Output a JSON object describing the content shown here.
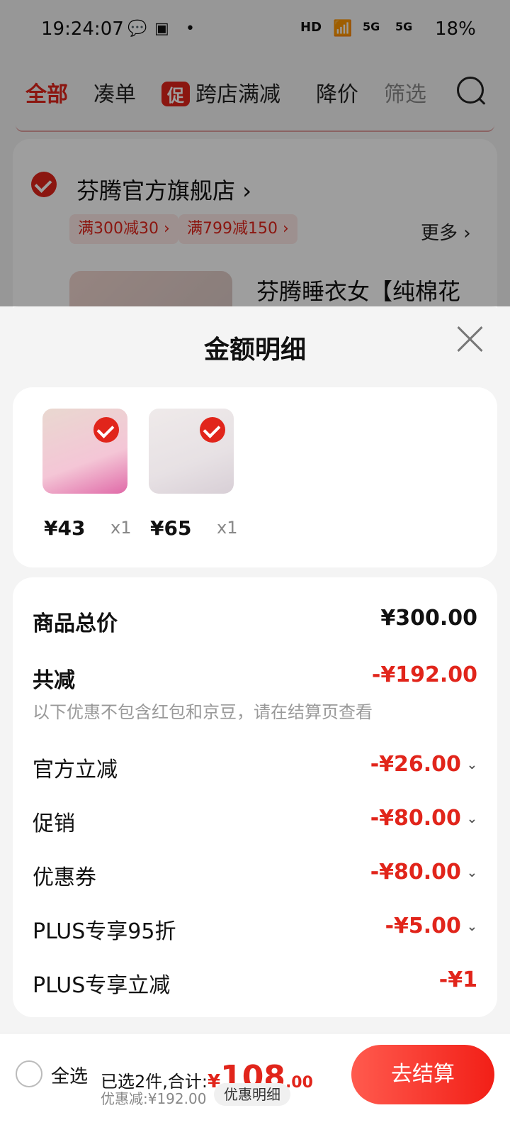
{
  "status_bar": {
    "time": "19:24:07",
    "battery": "18%",
    "net1": "HD",
    "net2": "5G",
    "net3": "5G"
  },
  "tabs": [
    {
      "label": "全部"
    },
    {
      "label": "凑单"
    },
    {
      "label": "跨店满减",
      "tag": "促"
    },
    {
      "label": "降价"
    },
    {
      "label": "筛选"
    }
  ],
  "store": {
    "name": "芬腾官方旗舰店",
    "chips": [
      "满300减30 ›",
      "满799减150 ›"
    ],
    "more": "更多 ›",
    "product_title": "芬腾睡衣女【纯棉花"
  },
  "sheet": {
    "title": "金额明细",
    "items": [
      {
        "price": "¥43",
        "qty": "x1"
      },
      {
        "price": "¥65",
        "qty": "x1"
      }
    ],
    "total_label": "商品总价",
    "total_value": "¥300.00",
    "reduce_label": "共减",
    "reduce_value": "-¥192.00",
    "note": "以下优惠不包含红包和京豆，请在结算页查看",
    "rows": [
      {
        "label": "官方立减",
        "value": "-¥26.00"
      },
      {
        "label": "促销",
        "value": "-¥80.00"
      },
      {
        "label": "优惠券",
        "value": "-¥80.00"
      },
      {
        "label": "PLUS专享95折",
        "value": "-¥5.00"
      },
      {
        "label": "PLUS专享立减",
        "value": "-¥1"
      }
    ]
  },
  "bottom": {
    "select_all": "全选",
    "selected_text": "已选2件,合计:",
    "currency": "¥",
    "amount": "108",
    "decimal": ".00",
    "discount_text": "优惠减:¥192.00",
    "detail_button": "优惠明细",
    "checkout_button": "去结算"
  },
  "colors": {
    "accent": "#e1251b"
  }
}
